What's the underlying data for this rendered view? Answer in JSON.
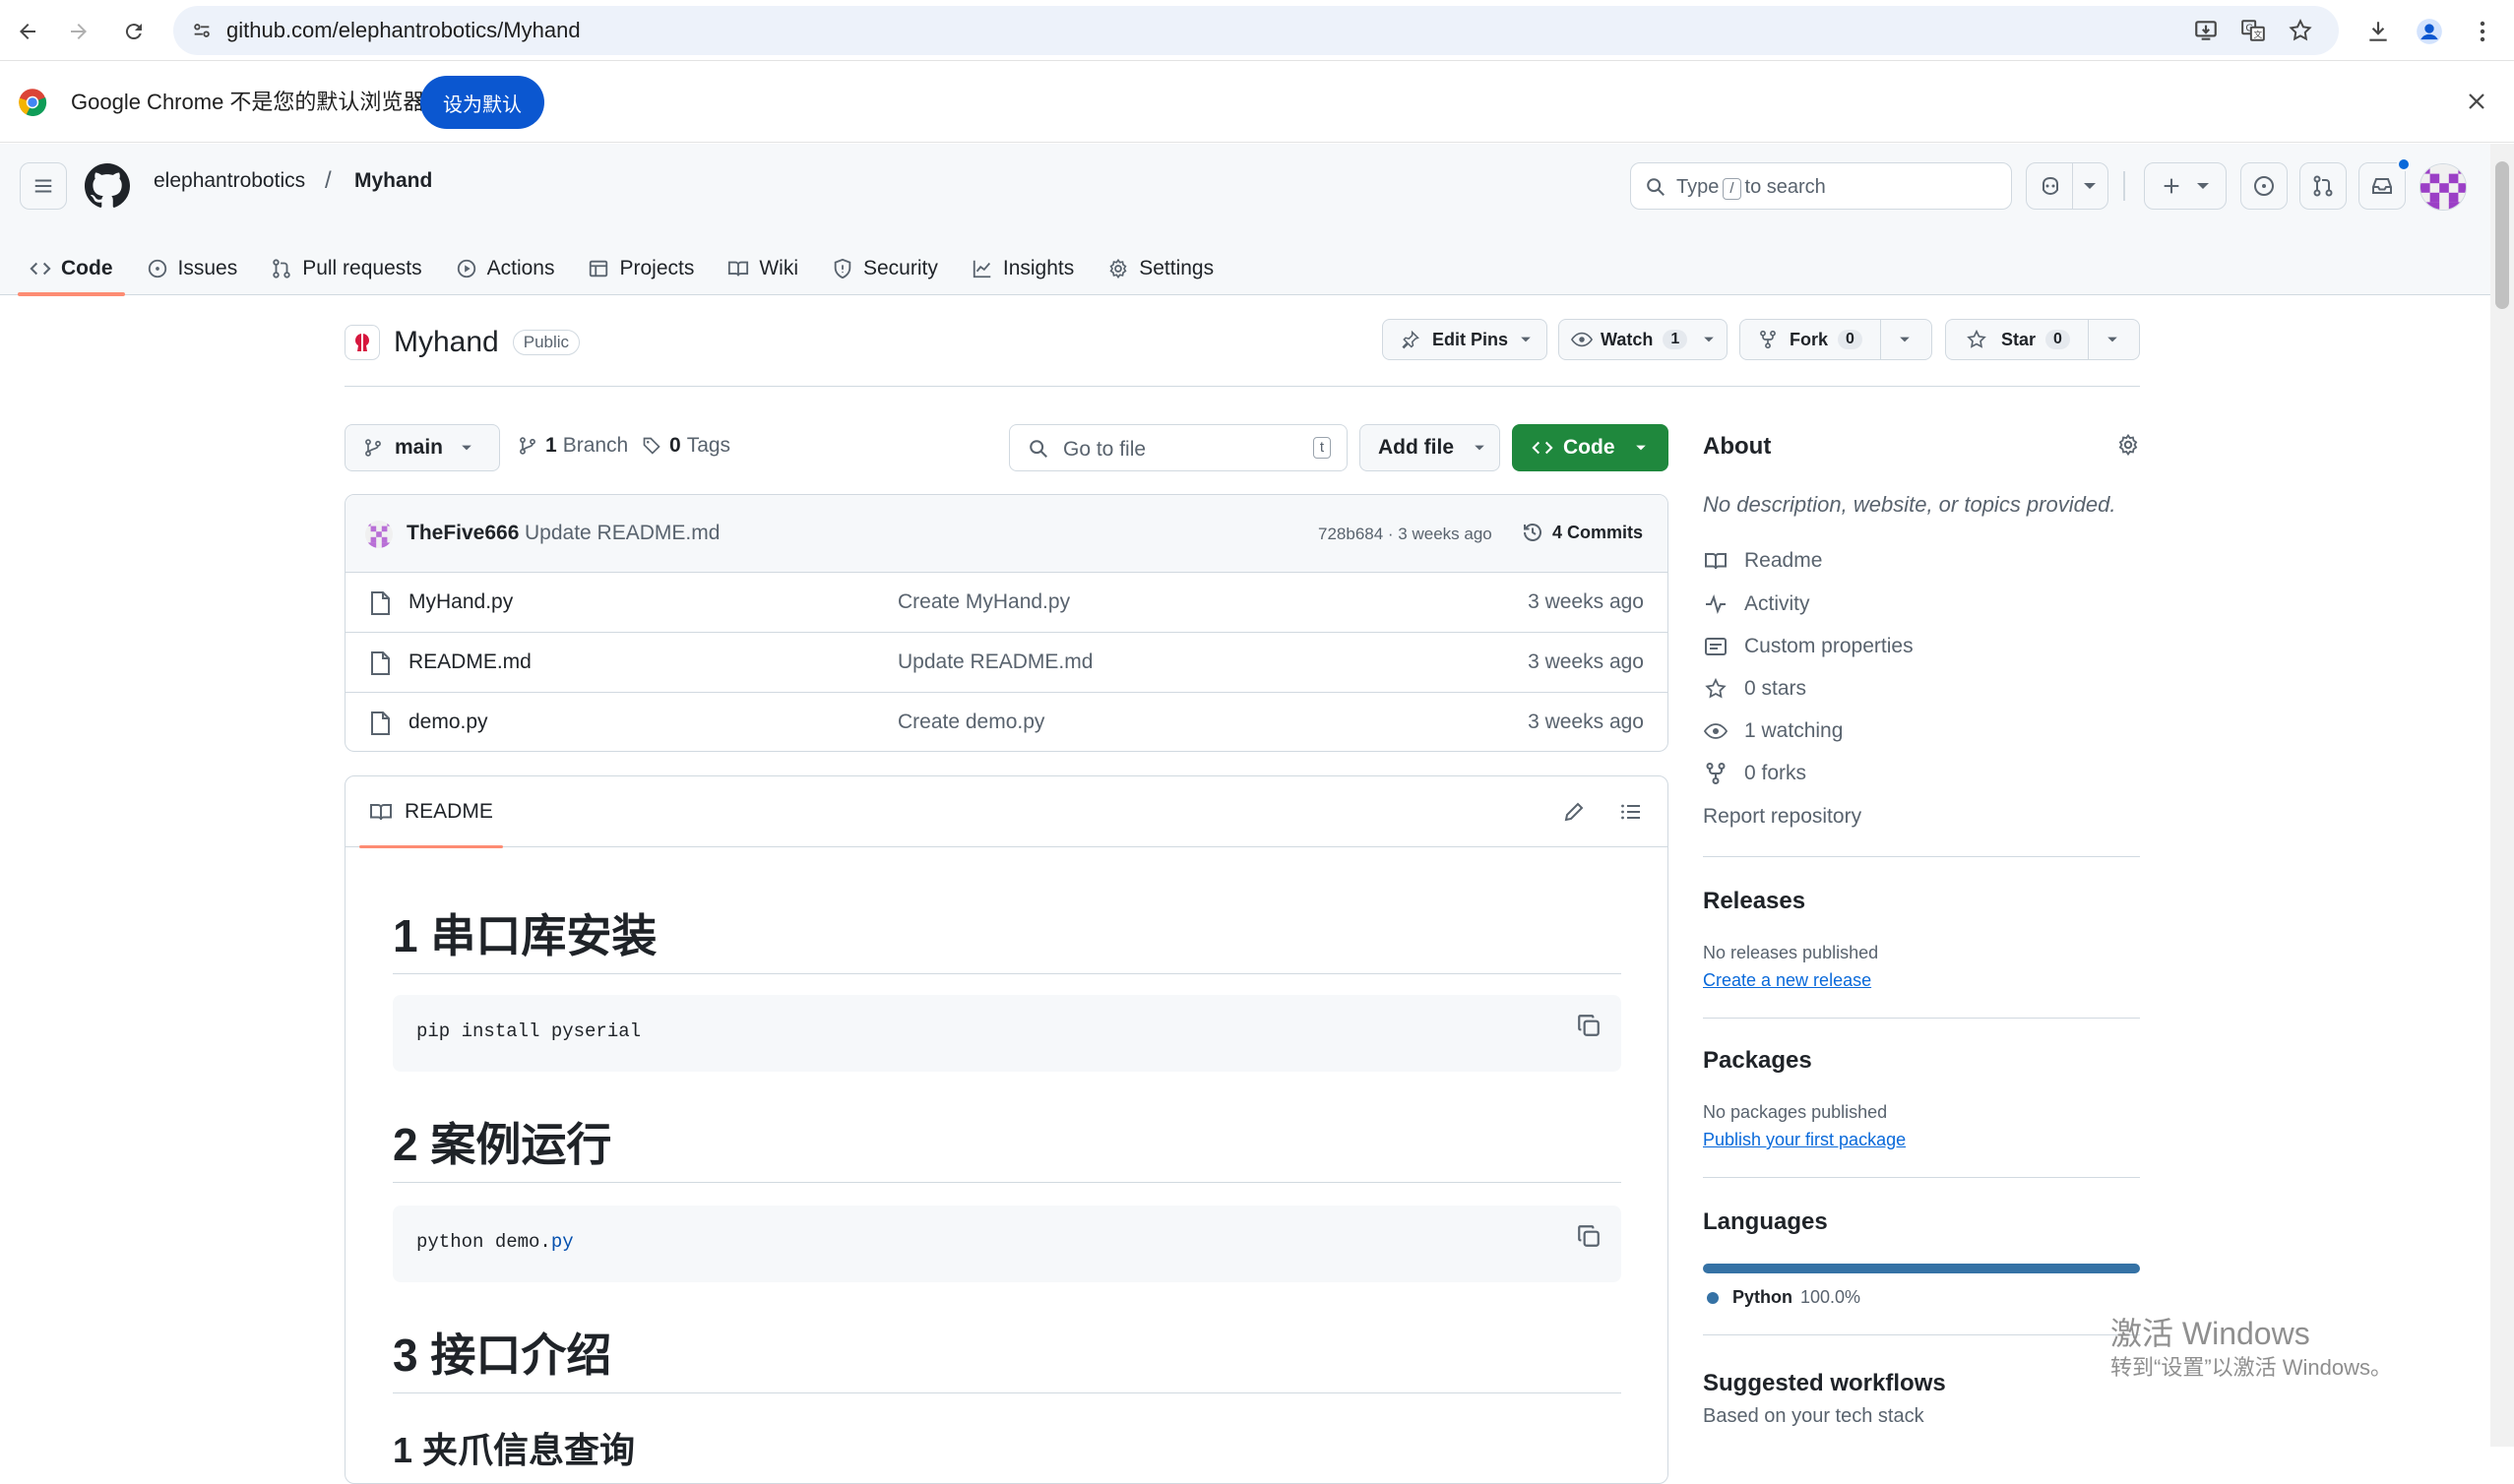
{
  "browser": {
    "url": "github.com/elephantrobotics/Myhand",
    "infobar_message": "Google Chrome 不是您的默认浏览器",
    "set_default_label": "设为默认"
  },
  "header": {
    "owner": "elephantrobotics",
    "separator": "/",
    "repo": "Myhand",
    "search_prefix": "Type",
    "search_key": "/",
    "search_suffix": "to search"
  },
  "tabs": [
    {
      "label": "Code",
      "icon": "code-icon"
    },
    {
      "label": "Issues",
      "icon": "issue-icon"
    },
    {
      "label": "Pull requests",
      "icon": "pull-request-icon"
    },
    {
      "label": "Actions",
      "icon": "play-icon"
    },
    {
      "label": "Projects",
      "icon": "table-icon"
    },
    {
      "label": "Wiki",
      "icon": "book-icon"
    },
    {
      "label": "Security",
      "icon": "shield-icon"
    },
    {
      "label": "Insights",
      "icon": "graph-icon"
    },
    {
      "label": "Settings",
      "icon": "gear-icon"
    }
  ],
  "repo": {
    "name": "Myhand",
    "visibility": "Public",
    "edit_pins": "Edit Pins",
    "watch_label": "Watch",
    "watch_count": "1",
    "fork_label": "Fork",
    "fork_count": "0",
    "star_label": "Star",
    "star_count": "0"
  },
  "controls": {
    "branch": "main",
    "branches_count": "1",
    "branches_label": "Branch",
    "tags_count": "0",
    "tags_label": "Tags",
    "go_to_file_placeholder": "Go to file",
    "go_to_file_key": "t",
    "add_file": "Add file",
    "code": "Code"
  },
  "latest_commit": {
    "author": "TheFive666",
    "message": "Update README.md",
    "hash_time": "728b684 · 3 weeks ago",
    "commits_count": "4",
    "commits_label": "Commits"
  },
  "files": [
    {
      "name": "MyHand.py",
      "message": "Create MyHand.py",
      "age": "3 weeks ago"
    },
    {
      "name": "README.md",
      "message": "Update README.md",
      "age": "3 weeks ago"
    },
    {
      "name": "demo.py",
      "message": "Create demo.py",
      "age": "3 weeks ago"
    }
  ],
  "readme": {
    "tab_label": "README",
    "h1_1": "1 串口库安装",
    "code_1": "pip install pyserial",
    "h1_2": "2 案例运行",
    "code_2_main": "python demo.",
    "code_2_ext": "py",
    "h1_3": "3 接口介绍",
    "h2_partial": "1 夹爪信息查询"
  },
  "about": {
    "title": "About",
    "description": "No description, website, or topics provided.",
    "items": [
      {
        "label": "Readme",
        "icon": "book-icon"
      },
      {
        "label": "Activity",
        "icon": "pulse-icon"
      },
      {
        "label": "Custom properties",
        "icon": "note-icon"
      },
      {
        "label": "0 stars",
        "icon": "star-icon"
      },
      {
        "label": "1 watching",
        "icon": "eye-icon"
      },
      {
        "label": "0 forks",
        "icon": "fork-icon"
      }
    ],
    "report": "Report repository"
  },
  "releases": {
    "title": "Releases",
    "none": "No releases published",
    "link": "Create a new release"
  },
  "packages": {
    "title": "Packages",
    "none": "No packages published",
    "link": "Publish your first package"
  },
  "languages": {
    "title": "Languages",
    "name": "Python",
    "percent": "100.0%",
    "value": 100.0,
    "color": "#3572A5"
  },
  "workflows": {
    "title": "Suggested workflows",
    "subtitle": "Based on your tech stack"
  },
  "watermark": {
    "line1": "激活 Windows",
    "line2": "转到“设置”以激活 Windows。"
  },
  "colors": {
    "accent_green": "#1f883d",
    "tab_underline": "#fd8c73",
    "chrome_blue": "#0b57d0"
  }
}
